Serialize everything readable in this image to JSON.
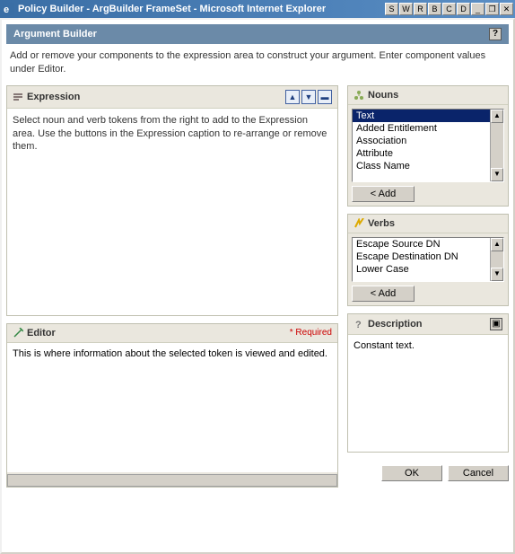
{
  "titlebar": {
    "text": "Policy Builder - ArgBuilder FrameSet - Microsoft Internet Explorer",
    "buttons": [
      "S",
      "W",
      "R",
      "B",
      "C",
      "D",
      "_",
      "❐",
      "✕"
    ]
  },
  "header": {
    "title": "Argument Builder",
    "help_icon": "?"
  },
  "instructions": "Add or remove your components to the expression area to construct your argument. Enter component values under Editor.",
  "expression": {
    "title": "Expression",
    "hint": "Select noun and verb tokens from the right to add to the Expression area.  Use the buttons in the Expression caption to re-arrange or remove them.",
    "btn_up": "▲",
    "btn_down": "▼",
    "btn_remove": "▬"
  },
  "nouns": {
    "title": "Nouns",
    "items": [
      "Text",
      "Added Entitlement",
      "Association",
      "Attribute",
      "Class Name"
    ],
    "selected": 0,
    "add_label": "< Add"
  },
  "verbs": {
    "title": "Verbs",
    "items": [
      "Escape Source DN",
      "Escape Destination DN",
      "Lower Case"
    ],
    "add_label": "< Add"
  },
  "editor": {
    "title": "Editor",
    "required_label": "* Required",
    "hint": "This is where information about the selected token is viewed and edited."
  },
  "description": {
    "title": "Description",
    "text": "Constant text."
  },
  "buttons": {
    "ok": "OK",
    "cancel": "Cancel"
  }
}
